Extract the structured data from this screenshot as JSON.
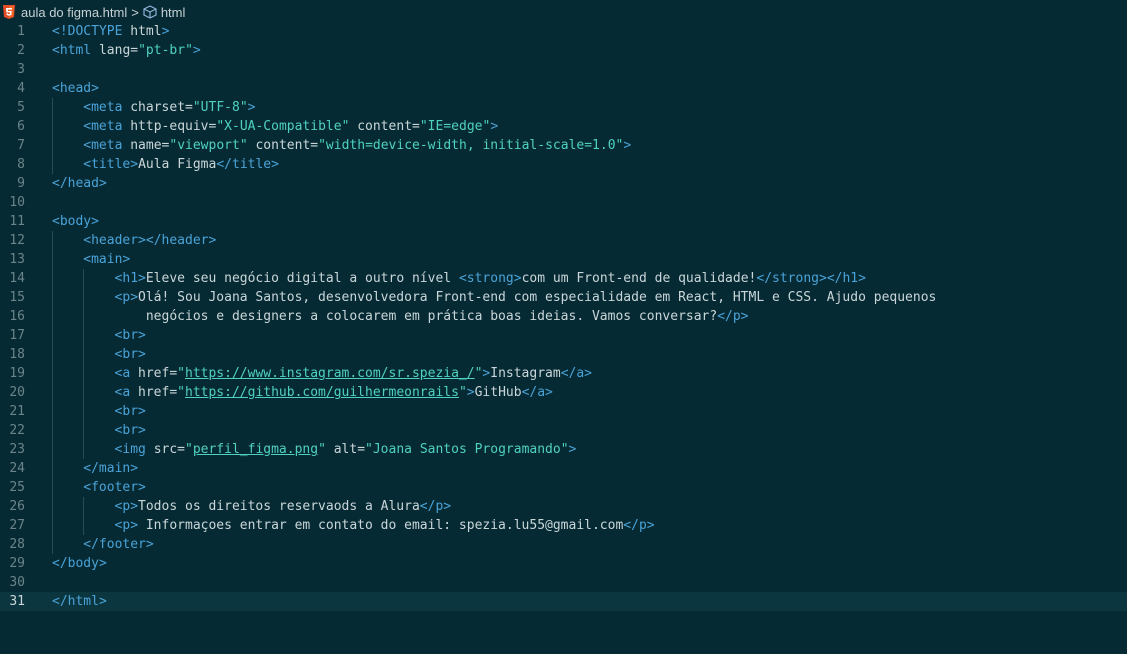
{
  "breadcrumb": {
    "file": "aula do figma.html",
    "separator": ">",
    "symbol": "html",
    "file_icon": "html5-icon",
    "symbol_icon": "cube-icon"
  },
  "colors": {
    "background": "#062a33",
    "tag": "#4aa3d8",
    "string": "#4fd1c1",
    "text": "#c9d6d9",
    "line_number": "#6b8489"
  },
  "editor": {
    "current_line": 31,
    "lines": [
      {
        "n": "1",
        "indent": 0,
        "html": "<span class='t'>&lt;!DOCTYPE</span> <span class='a'>html</span><span class='t'>&gt;</span>"
      },
      {
        "n": "2",
        "indent": 0,
        "html": "<span class='t'>&lt;html</span> <span class='a'>lang</span>=<span class='s'>\"pt-br\"</span><span class='t'>&gt;</span>"
      },
      {
        "n": "3",
        "indent": 0,
        "html": ""
      },
      {
        "n": "4",
        "indent": 0,
        "html": "<span class='t'>&lt;head&gt;</span>"
      },
      {
        "n": "5",
        "indent": 1,
        "html": "<span class='t'>&lt;meta</span> <span class='a'>charset</span>=<span class='s'>\"UTF-8\"</span><span class='t'>&gt;</span>"
      },
      {
        "n": "6",
        "indent": 1,
        "html": "<span class='t'>&lt;meta</span> <span class='a'>http-equiv</span>=<span class='s'>\"X-UA-Compatible\"</span> <span class='a'>content</span>=<span class='s'>\"IE=edge\"</span><span class='t'>&gt;</span>"
      },
      {
        "n": "7",
        "indent": 1,
        "html": "<span class='t'>&lt;meta</span> <span class='a'>name</span>=<span class='s'>\"viewport\"</span> <span class='a'>content</span>=<span class='s'>\"width=device-width, initial-scale=1.0\"</span><span class='t'>&gt;</span>"
      },
      {
        "n": "8",
        "indent": 1,
        "html": "<span class='t'>&lt;title&gt;</span>Aula Figma<span class='t'>&lt;/title&gt;</span>"
      },
      {
        "n": "9",
        "indent": 0,
        "html": "<span class='t'>&lt;/head&gt;</span>"
      },
      {
        "n": "10",
        "indent": 0,
        "html": ""
      },
      {
        "n": "11",
        "indent": 0,
        "html": "<span class='t'>&lt;body&gt;</span>"
      },
      {
        "n": "12",
        "indent": 1,
        "html": "<span class='t'>&lt;header&gt;&lt;/header&gt;</span>"
      },
      {
        "n": "13",
        "indent": 1,
        "html": "<span class='t'>&lt;main&gt;</span>"
      },
      {
        "n": "14",
        "indent": 2,
        "html": "<span class='t'>&lt;h1&gt;</span>Eleve seu negócio digital a outro nível <span class='t'>&lt;strong&gt;</span>com um Front-end de qualidade!<span class='t'>&lt;/strong&gt;&lt;/h1&gt;</span>"
      },
      {
        "n": "15",
        "indent": 2,
        "html": "<span class='t'>&lt;p&gt;</span>Olá! Sou Joana Santos, desenvolvedora Front-end com especialidade em React, HTML e CSS. Ajudo pequenos"
      },
      {
        "n": "16",
        "indent": 2,
        "html": "    negócios e designers a colocarem em prática boas ideias. Vamos conversar?<span class='t'>&lt;/p&gt;</span>"
      },
      {
        "n": "17",
        "indent": 2,
        "html": "<span class='t'>&lt;br&gt;</span>"
      },
      {
        "n": "18",
        "indent": 2,
        "html": "<span class='t'>&lt;br&gt;</span>"
      },
      {
        "n": "19",
        "indent": 2,
        "html": "<span class='t'>&lt;a</span> <span class='a'>href</span>=<span class='s'>\"</span><span class='u'>https://www.instagram.com/sr.spezia_/</span><span class='s'>\"</span><span class='t'>&gt;</span>Instagram<span class='t'>&lt;/a&gt;</span>"
      },
      {
        "n": "20",
        "indent": 2,
        "html": "<span class='t'>&lt;a</span> <span class='a'>href</span>=<span class='s'>\"</span><span class='u'>https://github.com/guilhermeonrails</span><span class='s'>\"</span><span class='t'>&gt;</span>GitHub<span class='t'>&lt;/a&gt;</span>"
      },
      {
        "n": "21",
        "indent": 2,
        "html": "<span class='t'>&lt;br&gt;</span>"
      },
      {
        "n": "22",
        "indent": 2,
        "html": "<span class='t'>&lt;br&gt;</span>"
      },
      {
        "n": "23",
        "indent": 2,
        "html": "<span class='t'>&lt;img</span> <span class='a'>src</span>=<span class='s'>\"</span><span class='u'>perfil_figma.png</span><span class='s'>\"</span> <span class='a'>alt</span>=<span class='s'>\"Joana Santos Programando\"</span><span class='t'>&gt;</span>"
      },
      {
        "n": "24",
        "indent": 1,
        "html": "<span class='t'>&lt;/main&gt;</span>"
      },
      {
        "n": "25",
        "indent": 1,
        "html": "<span class='t'>&lt;footer&gt;</span>"
      },
      {
        "n": "26",
        "indent": 2,
        "html": "<span class='t'>&lt;p&gt;</span>Todos os direitos reservaods a Alura<span class='t'>&lt;/p&gt;</span>"
      },
      {
        "n": "27",
        "indent": 2,
        "html": "<span class='t'>&lt;p&gt;</span> Informaçoes entrar em contato do email: spezia.lu55@gmail.com<span class='t'>&lt;/p&gt;</span>"
      },
      {
        "n": "28",
        "indent": 1,
        "html": "<span class='t'>&lt;/footer&gt;</span>"
      },
      {
        "n": "29",
        "indent": 0,
        "html": "<span class='t'>&lt;/body&gt;</span>"
      },
      {
        "n": "30",
        "indent": 0,
        "html": ""
      },
      {
        "n": "31",
        "indent": 0,
        "html": "<span class='t'>&lt;/html&gt;</span>"
      }
    ]
  }
}
